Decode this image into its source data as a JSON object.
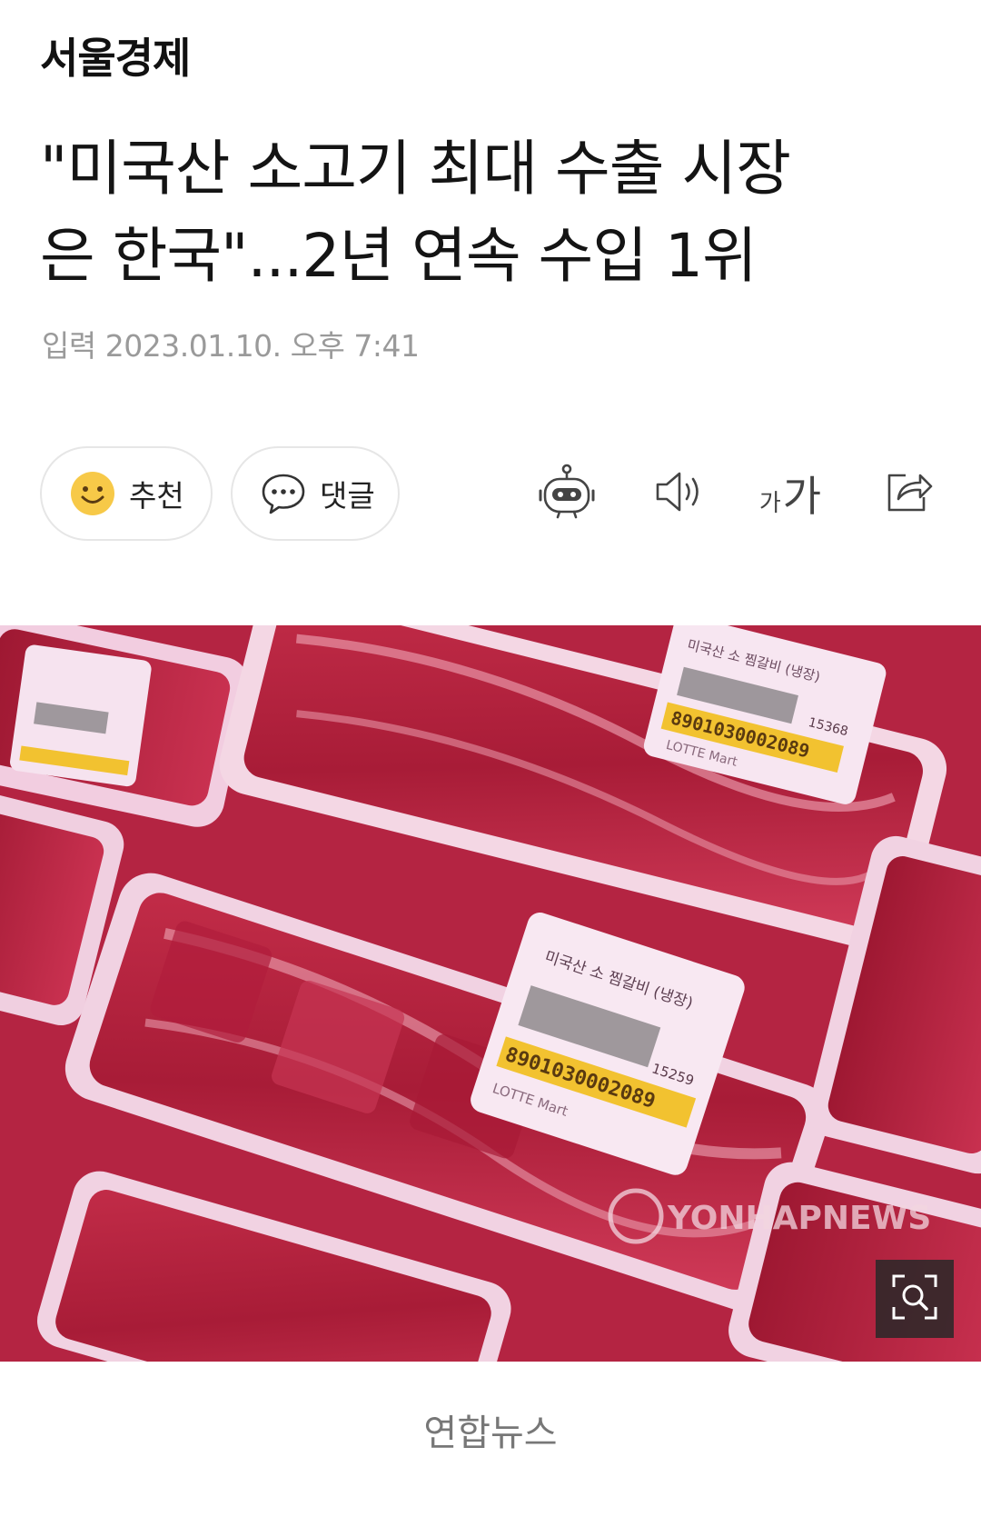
{
  "publisher": "서울경제",
  "article": {
    "headline_line1": "\"미국산 소고기 최대 수출 시장",
    "headline_line2": "은 한국\"...2년 연속 수입 1위",
    "date_label": "입력",
    "date_value": "2023.01.10. 오후 7:41"
  },
  "actions": {
    "recommend_label": "추천",
    "comment_label": "댓글",
    "font_small": "가",
    "font_large": "가"
  },
  "photo": {
    "watermark": "YONHAPNEWS",
    "label_barcode": "8901030002089",
    "label_price_1": "15368",
    "label_price_2": "15259",
    "label_title": "미국산 소 찜갈비 (냉장)",
    "label_store": "LOTTE Mart",
    "caption": "연합뉴스"
  },
  "icons": {
    "recommend": "smiley-icon",
    "comment": "speech-bubble-icon",
    "bot": "robot-icon",
    "speaker": "speaker-icon",
    "font": "font-size-icon",
    "share": "share-icon",
    "zoom": "zoom-icon"
  },
  "colors": {
    "smiley": "#f7c948",
    "meat": "#b8233f",
    "tray": "#f4d7e4",
    "label_yellow": "#f2c230"
  }
}
